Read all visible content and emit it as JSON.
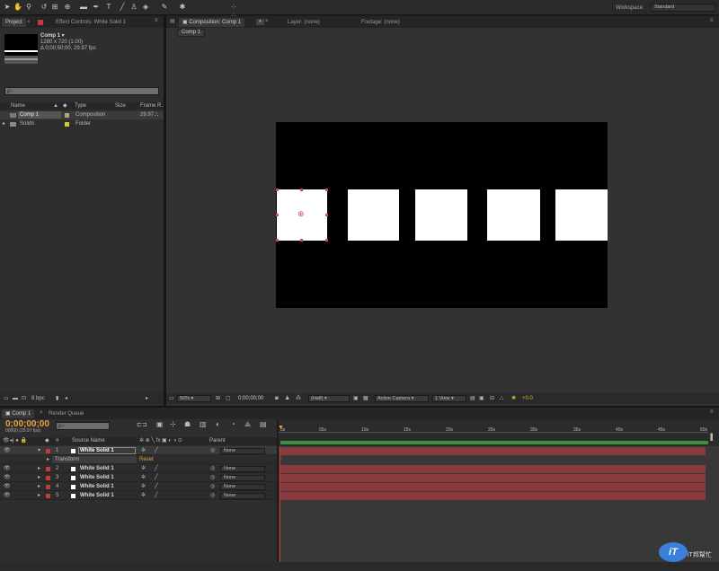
{
  "toolbar": {
    "tools": [
      "select-tool",
      "hand-tool",
      "zoom-tool",
      "rotate-tool",
      "camera-tool",
      "pan-behind-tool",
      "rectangle-tool",
      "pen-tool",
      "type-tool",
      "brush-tool",
      "clone-stamp-tool",
      "eraser-tool",
      "roto-brush-tool",
      "puppet-tool"
    ],
    "workspace_label": "Workspace:",
    "workspace_value": "Standard"
  },
  "project_panel": {
    "tab_project": "Project",
    "tab_effect_controls": "Effect Controls: White Solid 1",
    "comp_name": "Comp 1 ▾",
    "comp_size": "1280 x 720 (1.00)",
    "comp_duration": "Δ 0;00;50;00, 29.97 fps",
    "search_placeholder": "ρ−",
    "columns": [
      "Name",
      "Type",
      "Size",
      "Frame R..."
    ],
    "items": [
      {
        "name": "Comp 1",
        "type": "Composition",
        "size": "",
        "frame_rate": "29.97"
      },
      {
        "name": "Solids",
        "type": "Folder",
        "size": "",
        "frame_rate": ""
      }
    ],
    "bpc": "8 bpc"
  },
  "comp_panel": {
    "tab_composition": "Composition: Comp 1",
    "tab_layer": "Layer: (none)",
    "tab_footage": "Footage: (none)",
    "breadcrumb": "Comp 1",
    "zoom": "50%",
    "timecode": "0;00;00;00",
    "resolution": "(Half)",
    "camera": "Active Camera",
    "views": "1 View",
    "exposure": "+0.0"
  },
  "timeline": {
    "tab_comp": "Comp 1",
    "tab_render": "Render Queue",
    "timecode": "0;00;00;00",
    "frame_info": "00000 (29.97 fps)",
    "search_placeholder": "ρ−",
    "col_hash": "#",
    "col_source": "Source Name",
    "col_parent": "Parent",
    "transform_label": "Transform",
    "reset_label": "Reset",
    "ruler_ticks": [
      "0s",
      "05s",
      "10s",
      "15s",
      "20s",
      "25s",
      "30s",
      "35s",
      "40s",
      "45s",
      "50s"
    ],
    "layers": [
      {
        "num": "1",
        "name": "White Solid 1",
        "parent": "None"
      },
      {
        "num": "2",
        "name": "White Solid 1",
        "parent": "None"
      },
      {
        "num": "3",
        "name": "White Solid 1",
        "parent": "None"
      },
      {
        "num": "4",
        "name": "White Solid 1",
        "parent": "None"
      },
      {
        "num": "5",
        "name": "White Solid 1",
        "parent": "None"
      }
    ]
  },
  "watermark": {
    "text": "iT邦幫忙"
  },
  "colors": {
    "layer_red": "#c23a3a",
    "track_red": "#8b3a3e",
    "timecode_orange": "#e8a33a",
    "accent_yellow": "#d6b32c"
  }
}
